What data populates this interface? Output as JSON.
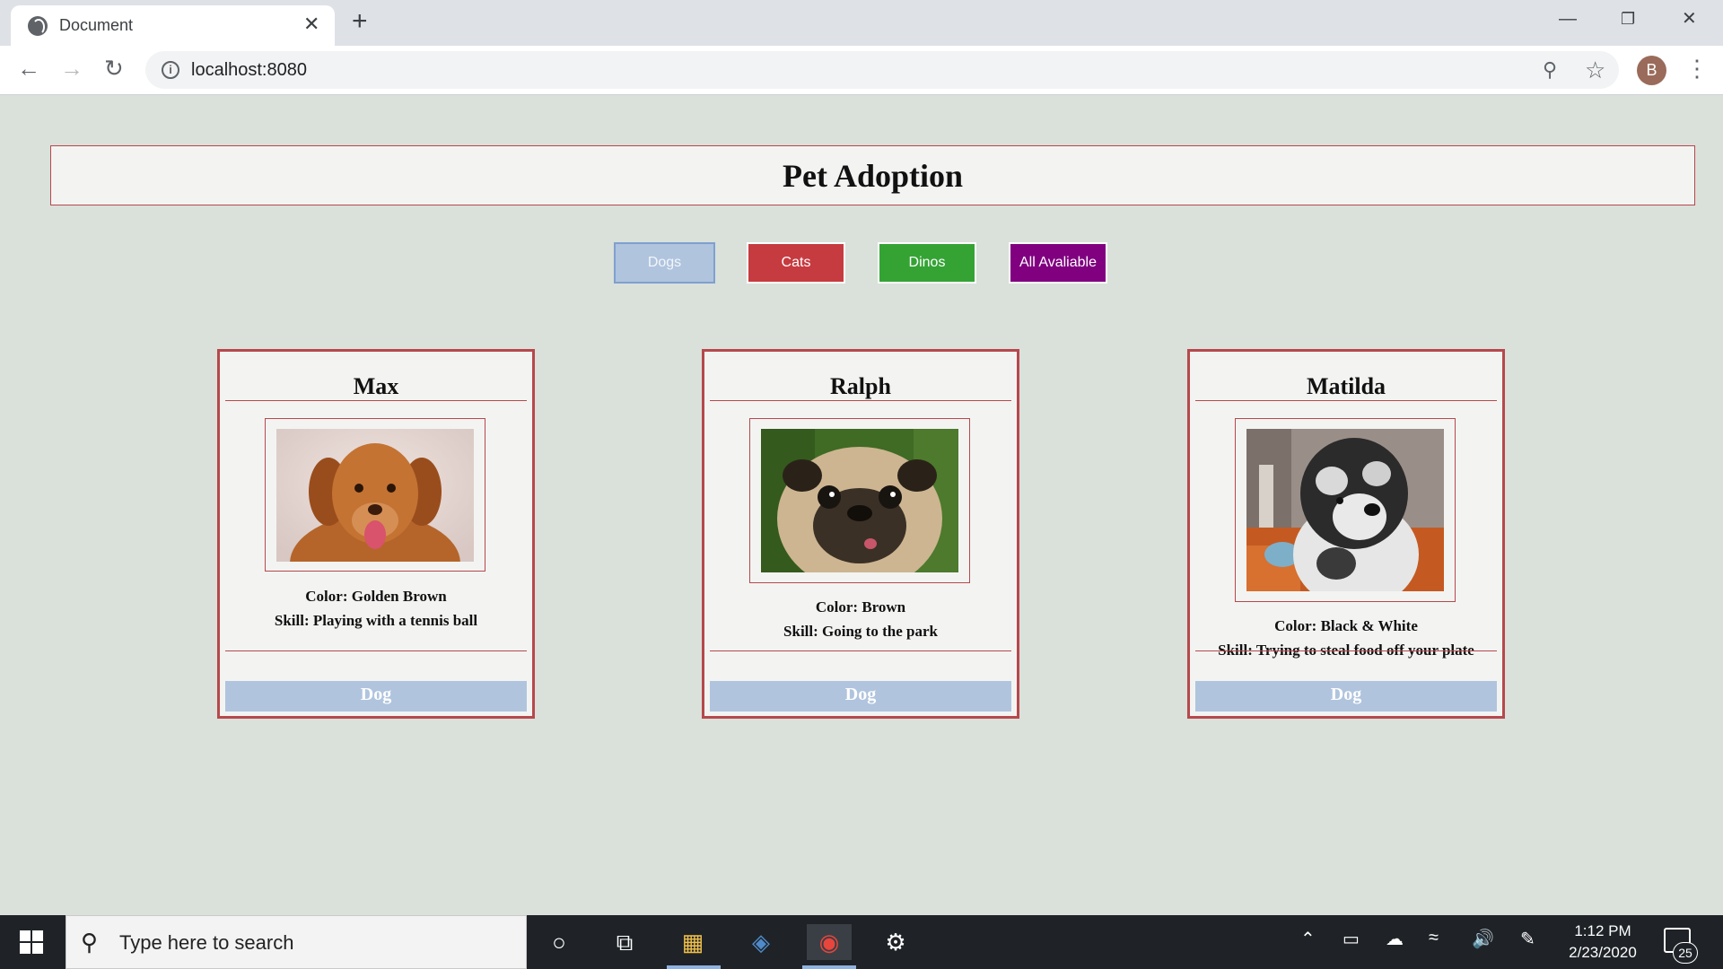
{
  "browser": {
    "tab_title": "Document",
    "url": "localhost:8080",
    "avatar_letter": "B"
  },
  "page": {
    "title": "Pet Adoption",
    "filters": [
      {
        "label": "Dogs",
        "color": "#b0c4de"
      },
      {
        "label": "Cats",
        "color": "#c63b40"
      },
      {
        "label": "Dinos",
        "color": "#34a334"
      },
      {
        "label": "All Avaliable",
        "color": "#800080"
      }
    ],
    "pets": [
      {
        "name": "Max",
        "color_line": "Color: Golden Brown",
        "skill_line": "Skill: Playing with a tennis ball",
        "type": "Dog"
      },
      {
        "name": "Ralph",
        "color_line": "Color: Brown",
        "skill_line": "Skill: Going to the park",
        "type": "Dog"
      },
      {
        "name": "Matilda",
        "color_line": "Color: Black & White",
        "skill_line": "Skill: Trying to steal food off your plate",
        "type": "Dog"
      }
    ]
  },
  "taskbar": {
    "search_placeholder": "Type here to search",
    "time": "1:12 PM",
    "date": "2/23/2020",
    "notification_count": "25"
  }
}
